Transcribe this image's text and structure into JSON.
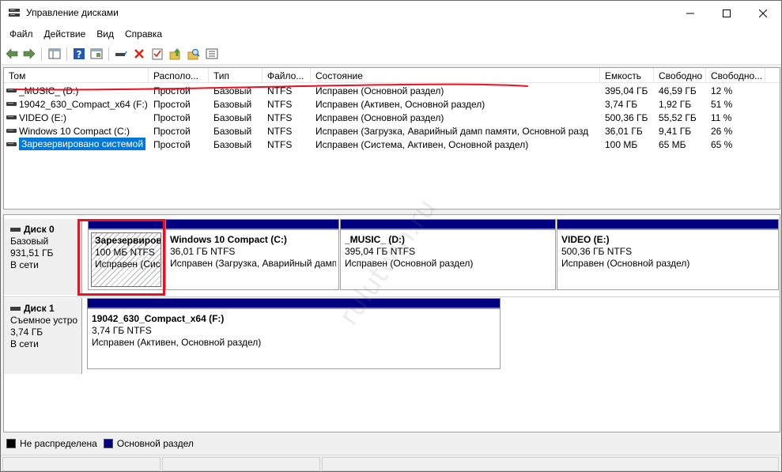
{
  "window": {
    "title": "Управление дисками"
  },
  "menu": [
    "Файл",
    "Действие",
    "Вид",
    "Справка"
  ],
  "toolbar": {
    "icons": [
      "back-arrow-icon",
      "forward-arrow-icon",
      "console-tree-icon",
      "help-icon",
      "export-list-icon",
      "connect-drive-icon",
      "delete-icon",
      "checklist-icon",
      "up-folder-icon",
      "search-volume-icon",
      "properties-icon"
    ]
  },
  "volumes": {
    "columns": [
      "Том",
      "Располо...",
      "Тип",
      "Файло...",
      "Состояние",
      "Емкость",
      "Свободно",
      "Свободно..."
    ],
    "rows": [
      [
        "_MUSIC_ (D:)",
        "Простой",
        "Базовый",
        "NTFS",
        "Исправен (Основной раздел)",
        "395,04 ГБ",
        "46,59 ГБ",
        "12 %"
      ],
      [
        "19042_630_Compact_x64 (F:)",
        "Простой",
        "Базовый",
        "NTFS",
        "Исправен (Активен, Основной раздел)",
        "3,74 ГБ",
        "1,92 ГБ",
        "51 %"
      ],
      [
        "VIDEO (E:)",
        "Простой",
        "Базовый",
        "NTFS",
        "Исправен (Основной раздел)",
        "500,36 ГБ",
        "55,52 ГБ",
        "11 %"
      ],
      [
        "Windows 10 Compact  (C:)",
        "Простой",
        "Базовый",
        "NTFS",
        "Исправен (Загрузка, Аварийный дамп памяти, Основной разд",
        "36,01 ГБ",
        "9,41 ГБ",
        "26 %"
      ],
      [
        "Зарезервировано системой",
        "Простой",
        "Базовый",
        "NTFS",
        "Исправен (Система, Активен, Основной раздел)",
        "100 МБ",
        "65 МБ",
        "65 %"
      ]
    ]
  },
  "disks": [
    {
      "title": "Диск 0",
      "lines": [
        "Базовый",
        "931,51 ГБ",
        "В сети"
      ],
      "partitions": [
        {
          "name": "Зарезервиров",
          "size": "100 МБ NTFS",
          "status": "Исправен (Сис"
        },
        {
          "name": "Windows 10 Compact   (C:)",
          "size": "36,01 ГБ NTFS",
          "status": "Исправен (Загрузка, Аварийный дамп"
        },
        {
          "name": "_MUSIC_  (D:)",
          "size": "395,04 ГБ NTFS",
          "status": "Исправен (Основной раздел)"
        },
        {
          "name": "VIDEO  (E:)",
          "size": "500,36 ГБ NTFS",
          "status": "Исправен (Основной раздел)"
        }
      ]
    },
    {
      "title": "Диск 1",
      "lines": [
        "Съемное устро",
        "3,74 ГБ",
        "В сети"
      ],
      "partitions": [
        {
          "name": "19042_630_Compact_x64  (F:)",
          "size": "3,74 ГБ NTFS",
          "status": "Исправен (Активен, Основной раздел)"
        }
      ]
    }
  ],
  "legend": [
    {
      "label": "Не распределена",
      "color": "#000000"
    },
    {
      "label": "Основной раздел",
      "color": "#000080"
    }
  ],
  "watermark": "rulutwin.ru",
  "colors": {
    "selection": "#0078d7",
    "partition_bar": "#000080",
    "annotation": "#e81123"
  }
}
